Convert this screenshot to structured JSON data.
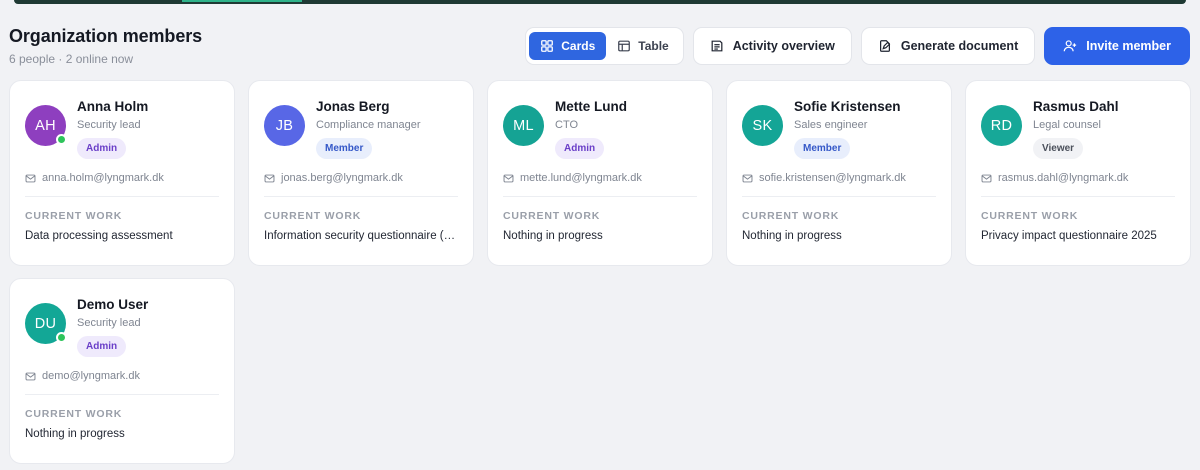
{
  "header": {
    "title": "Organization members",
    "subtitle": "6 people · 2 online now"
  },
  "toolbar": {
    "view_cards": "Cards",
    "view_table": "Table",
    "activity": "Activity overview",
    "generate": "Generate document",
    "invite": "Invite member"
  },
  "current_work_label": "CURRENT WORK",
  "members": [
    {
      "initials": "AH",
      "name": "Anna Holm",
      "title": "Security lead",
      "role": "Admin",
      "email": "anna.holm@lyngmark.dk",
      "current_work": "Data processing assessment",
      "online": true,
      "color": "#8e3fbf"
    },
    {
      "initials": "JB",
      "name": "Jonas Berg",
      "title": "Compliance manager",
      "role": "Member",
      "email": "jonas.berg@lyngmark.dk",
      "current_work": "Information security questionnaire (S...",
      "online": false,
      "color": "#5867e6"
    },
    {
      "initials": "ML",
      "name": "Mette Lund",
      "title": "CTO",
      "role": "Admin",
      "email": "mette.lund@lyngmark.dk",
      "current_work": "Nothing in progress",
      "online": false,
      "color": "#15a394"
    },
    {
      "initials": "SK",
      "name": "Sofie Kristensen",
      "title": "Sales engineer",
      "role": "Member",
      "email": "sofie.kristensen@lyngmark.dk",
      "current_work": "Nothing in progress",
      "online": false,
      "color": "#14a596"
    },
    {
      "initials": "RD",
      "name": "Rasmus Dahl",
      "title": "Legal counsel",
      "role": "Viewer",
      "email": "rasmus.dahl@lyngmark.dk",
      "current_work": "Privacy impact questionnaire 2025",
      "online": false,
      "color": "#17a898"
    },
    {
      "initials": "DU",
      "name": "Demo User",
      "title": "Security lead",
      "role": "Admin",
      "email": "demo@lyngmark.dk",
      "current_work": "Nothing in progress",
      "online": true,
      "color": "#13a796"
    }
  ]
}
